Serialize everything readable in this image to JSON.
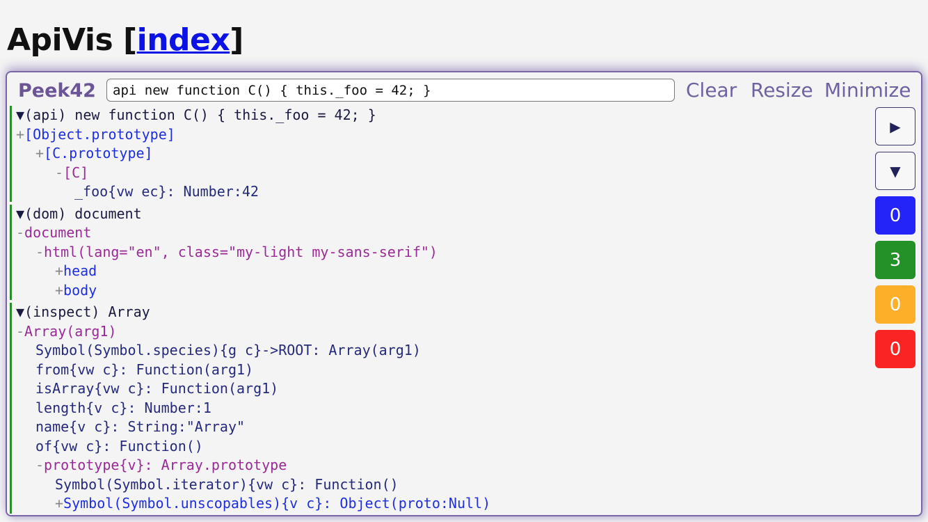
{
  "page": {
    "title_prefix": "ApiVis [",
    "title_link": "index",
    "title_suffix": "]"
  },
  "panel": {
    "brand": "Peek42",
    "query_value": "api new function C() { this._foo = 42; }",
    "buttons": {
      "clear": "Clear",
      "resize": "Resize",
      "minimize": "Minimize"
    }
  },
  "side": {
    "expand_icon": "▶",
    "collapse_icon": "▼",
    "counters": [
      {
        "name": "info",
        "value": "0",
        "color": "#2424f8"
      },
      {
        "name": "success",
        "value": "3",
        "color": "#249028"
      },
      {
        "name": "warning",
        "value": "0",
        "color": "#fcb02a"
      },
      {
        "name": "error",
        "value": "0",
        "color": "#fa2424"
      }
    ]
  },
  "blocks": [
    {
      "header": "▼(api) new function C() { this._foo = 42; }",
      "lines": [
        {
          "prefix": "+",
          "text": "[Object.prototype]",
          "color": "blue",
          "indent": 0
        },
        {
          "prefix": "+",
          "text": "[C.prototype]",
          "color": "blue",
          "indent": 1
        },
        {
          "prefix": "-",
          "text": "[C]",
          "color": "purple",
          "indent": 2
        },
        {
          "prefix": "",
          "text": "_foo{vw ec}: Number:42",
          "color": "navy",
          "indent": 3
        }
      ]
    },
    {
      "header": "▼(dom) document",
      "lines": [
        {
          "prefix": "-",
          "text": "document",
          "color": "purple",
          "indent": 0
        },
        {
          "prefix": "-",
          "text": "html(lang=\"en\", class=\"my-light my-sans-serif\")",
          "color": "purple",
          "indent": 1
        },
        {
          "prefix": "+",
          "text": "head",
          "color": "blue",
          "indent": 2
        },
        {
          "prefix": "+",
          "text": "body",
          "color": "blue",
          "indent": 2
        }
      ]
    },
    {
      "header": "▼(inspect) Array",
      "lines": [
        {
          "prefix": "-",
          "text": "Array(arg1)",
          "color": "purple",
          "indent": 0
        },
        {
          "prefix": "",
          "text": "Symbol(Symbol.species){g c}->ROOT: Array(arg1)",
          "color": "navy",
          "indent": 1
        },
        {
          "prefix": "",
          "text": "from{vw c}: Function(arg1)",
          "color": "navy",
          "indent": 1
        },
        {
          "prefix": "",
          "text": "isArray{vw c}: Function(arg1)",
          "color": "navy",
          "indent": 1
        },
        {
          "prefix": "",
          "text": "length{v c}: Number:1",
          "color": "navy",
          "indent": 1
        },
        {
          "prefix": "",
          "text": "name{v c}: String:\"Array\"",
          "color": "navy",
          "indent": 1
        },
        {
          "prefix": "",
          "text": "of{vw c}: Function()",
          "color": "navy",
          "indent": 1
        },
        {
          "prefix": "-",
          "text": "prototype{v}: Array.prototype",
          "color": "purple",
          "indent": 1
        },
        {
          "prefix": "",
          "text": "Symbol(Symbol.iterator){vw c}: Function()",
          "color": "navy",
          "indent": 2
        },
        {
          "prefix": "+",
          "text": "Symbol(Symbol.unscopables){v c}: Object(proto:Null)",
          "color": "blue",
          "indent": 2
        }
      ]
    }
  ]
}
